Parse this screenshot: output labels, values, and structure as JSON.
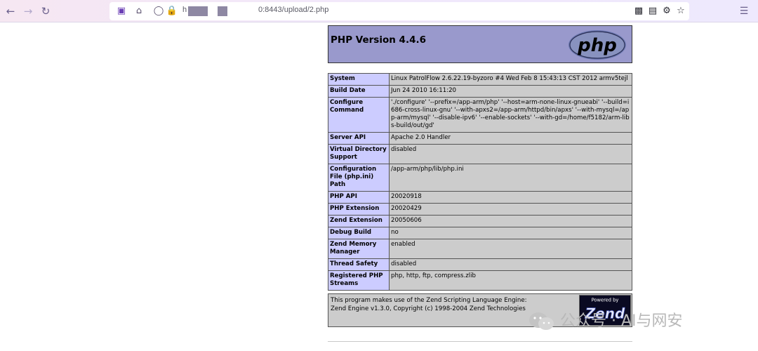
{
  "browser": {
    "url_prefix": "h",
    "url_suffix": "0:8443/upload/2.php"
  },
  "phpinfo": {
    "title": "PHP Version 4.4.6",
    "logo_text": "php",
    "rows": [
      {
        "label": "System",
        "value": "Linux PatrolFlow 2.6.22.19-byzoro #4 Wed Feb 8 15:43:13 CST 2012 armv5tejl"
      },
      {
        "label": "Build Date",
        "value": "Jun 24 2010 16:11:20"
      },
      {
        "label": "Configure Command",
        "value": "'./configure' '--prefix=/app-arm/php' '--host=arm-none-linux-gnueabi' '--build=i686-cross-linux-gnu' '--with-apxs2=/app-arm/httpd/bin/apxs' '--with-mysql=/app-arm/mysql' '--disable-ipv6' '--enable-sockets' '--with-gd=/home/f5182/arm-libs-build/out/gd'"
      },
      {
        "label": "Server API",
        "value": "Apache 2.0 Handler"
      },
      {
        "label": "Virtual Directory Support",
        "value": "disabled"
      },
      {
        "label": "Configuration File (php.ini) Path",
        "value": "/app-arm/php/lib/php.ini"
      },
      {
        "label": "PHP API",
        "value": "20020918"
      },
      {
        "label": "PHP Extension",
        "value": "20020429"
      },
      {
        "label": "Zend Extension",
        "value": "20050606"
      },
      {
        "label": "Debug Build",
        "value": "no"
      },
      {
        "label": "Zend Memory Manager",
        "value": "enabled"
      },
      {
        "label": "Thread Safety",
        "value": "disabled"
      },
      {
        "label": "Registered PHP Streams",
        "value": "php, http, ftp, compress.zlib"
      }
    ],
    "footer": {
      "line1": "This program makes use of the Zend Scripting Language Engine:",
      "line2": "Zend Engine v1.3.0, Copyright (c) 1998-2004 Zend Technologies",
      "logo_top": "Powered by",
      "logo_main": "Zend"
    }
  },
  "watermark": {
    "text": "公众号 · AI与网安"
  },
  "colors": {
    "header_bg": "#9999cc",
    "label_bg": "#ccccff",
    "value_bg": "#cccccc"
  }
}
